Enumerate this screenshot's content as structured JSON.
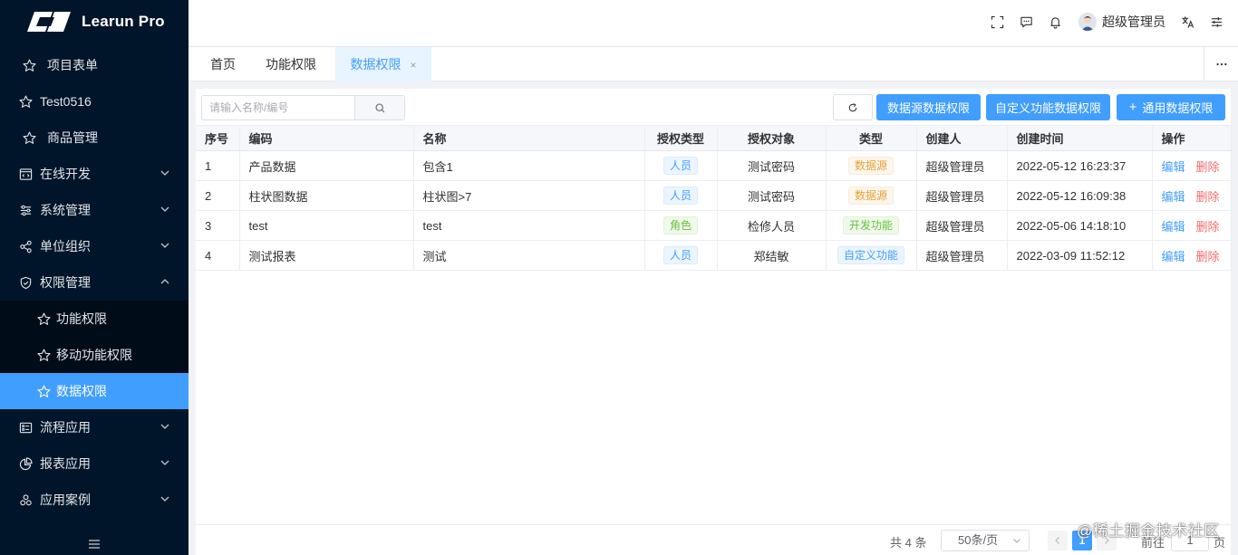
{
  "app": {
    "title": "Learun Pro"
  },
  "sidebar": {
    "items": [
      {
        "label": "项目表单",
        "icon": "star-icon"
      },
      {
        "label": "Test0516",
        "icon": "star-icon"
      },
      {
        "label": "商品管理",
        "icon": "star-icon"
      },
      {
        "label": "在线开发",
        "icon": "code-window-icon"
      },
      {
        "label": "系统管理",
        "icon": "sliders-icon"
      },
      {
        "label": "单位组织",
        "icon": "share-icon"
      },
      {
        "label": "权限管理",
        "icon": "shield-check-icon"
      },
      {
        "label": "流程应用",
        "icon": "form-list-icon"
      },
      {
        "label": "报表应用",
        "icon": "pie-chart-icon"
      },
      {
        "label": "应用案例",
        "icon": "cluster-icon"
      }
    ],
    "sub_items": [
      {
        "label": "功能权限",
        "icon": "star-icon"
      },
      {
        "label": "移动功能权限",
        "icon": "star-icon"
      },
      {
        "label": "数据权限",
        "icon": "star-icon"
      }
    ],
    "active_color": "#409eff"
  },
  "header": {
    "user_name": "超级管理员"
  },
  "tabs": [
    {
      "label": "首页"
    },
    {
      "label": "功能权限"
    },
    {
      "label": "数据权限",
      "close": "×"
    }
  ],
  "toolbar": {
    "search_placeholder": "请输入名称/编号",
    "btn_datasource": "数据源数据权限",
    "btn_custom": "自定义功能数据权限",
    "btn_general_plus": "+",
    "btn_general": "通用数据权限"
  },
  "table": {
    "headers": [
      "序号",
      "编码",
      "名称",
      "授权类型",
      "授权对象",
      "类型",
      "创建人",
      "创建时间",
      "操作"
    ],
    "rows": [
      {
        "no": "1",
        "code": "产品数据",
        "name": "包含1",
        "auth_type": "人员",
        "auth_obj": "测试密码",
        "type": "数据源",
        "creator": "超级管理员",
        "created": "2022-05-12 16:23:37"
      },
      {
        "no": "2",
        "code": "柱状图数据",
        "name": "柱状图>7",
        "auth_type": "人员",
        "auth_obj": "测试密码",
        "type": "数据源",
        "creator": "超级管理员",
        "created": "2022-05-12 16:09:38"
      },
      {
        "no": "3",
        "code": "test",
        "name": "test",
        "auth_type": "角色",
        "auth_obj": "检修人员",
        "type": "开发功能",
        "creator": "超级管理员",
        "created": "2022-05-06 14:18:10"
      },
      {
        "no": "4",
        "code": "测试报表",
        "name": "测试",
        "auth_type": "人员",
        "auth_obj": "郑结敏",
        "type": "自定义功能",
        "creator": "超级管理员",
        "created": "2022-03-09 11:52:12"
      }
    ],
    "op_edit": "编辑",
    "op_delete": "删除"
  },
  "pagination": {
    "total": "共 4 条",
    "page_size": "50条/页",
    "current": "1",
    "goto": "前往",
    "goto_value": "1",
    "page_unit": "页"
  },
  "watermark": "@稀土掘金技术社区"
}
